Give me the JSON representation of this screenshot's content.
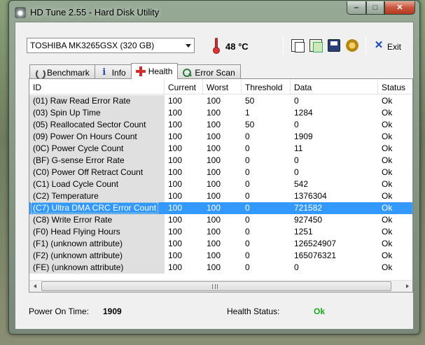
{
  "window": {
    "title": "HD Tune 2.55 - Hard Disk Utility",
    "controls": {
      "minimize": "‒",
      "maximize": "□",
      "close": "✕"
    }
  },
  "toolbar": {
    "disk": "TOSHIBA MK3265GSX (320 GB)",
    "temperature": "48 °C",
    "exit_label": "Exit",
    "icons": [
      "copy-icon",
      "copy-all-icon",
      "save-icon",
      "options-icon",
      "exit-icon"
    ]
  },
  "tabs": [
    {
      "label": "Benchmark",
      "icon": "benchmark-icon",
      "active": false
    },
    {
      "label": "Info",
      "icon": "info-icon",
      "active": false
    },
    {
      "label": "Health",
      "icon": "health-icon",
      "active": true
    },
    {
      "label": "Error Scan",
      "icon": "error-scan-icon",
      "active": false
    }
  ],
  "table": {
    "columns": [
      "ID",
      "Current",
      "Worst",
      "Threshold",
      "Data",
      "Status"
    ],
    "rows": [
      [
        "(01) Raw Read Error Rate",
        "100",
        "100",
        "50",
        "0",
        "Ok"
      ],
      [
        "(03) Spin Up Time",
        "100",
        "100",
        "1",
        "1284",
        "Ok"
      ],
      [
        "(05) Reallocated Sector Count",
        "100",
        "100",
        "50",
        "0",
        "Ok"
      ],
      [
        "(09) Power On Hours Count",
        "100",
        "100",
        "0",
        "1909",
        "Ok"
      ],
      [
        "(0C) Power Cycle Count",
        "100",
        "100",
        "0",
        "11",
        "Ok"
      ],
      [
        "(BF) G-sense Error Rate",
        "100",
        "100",
        "0",
        "0",
        "Ok"
      ],
      [
        "(C0) Power Off Retract Count",
        "100",
        "100",
        "0",
        "0",
        "Ok"
      ],
      [
        "(C1) Load Cycle Count",
        "100",
        "100",
        "0",
        "542",
        "Ok"
      ],
      [
        "(C2) Temperature",
        "100",
        "100",
        "0",
        "1376304",
        "Ok"
      ],
      [
        "(C7) Ultra DMA CRC Error Count",
        "100",
        "100",
        "0",
        "721582",
        "Ok"
      ],
      [
        "(C8) Write Error Rate",
        "100",
        "100",
        "0",
        "927450",
        "Ok"
      ],
      [
        "(F0) Head Flying Hours",
        "100",
        "100",
        "0",
        "1251",
        "Ok"
      ],
      [
        "(F1) (unknown attribute)",
        "100",
        "100",
        "0",
        "126524907",
        "Ok"
      ],
      [
        "(F2) (unknown attribute)",
        "100",
        "100",
        "0",
        "165076321",
        "Ok"
      ],
      [
        "(FE) (unknown attribute)",
        "100",
        "100",
        "0",
        "0",
        "Ok"
      ]
    ],
    "selected_row": 9
  },
  "footer": {
    "power_on_label": "Power On Time:",
    "power_on_value": "1909",
    "health_label": "Health Status:",
    "health_value": "Ok"
  },
  "colors": {
    "selection": "#3399ff",
    "health_ok": "#1aa81a",
    "id_column_bg": "#e0e0e0"
  }
}
